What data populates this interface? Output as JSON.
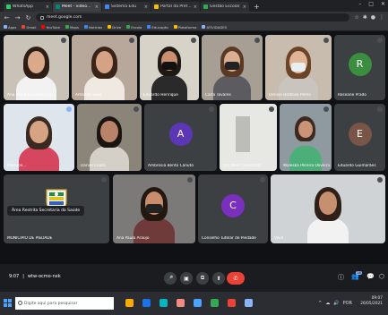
{
  "browser": {
    "tabs": [
      {
        "label": "WhatsApp",
        "fav": "#25d366",
        "active": false
      },
      {
        "label": "Meet - videochamada",
        "fav": "#00897b",
        "active": true
      },
      {
        "label": "Sistema Edu",
        "fav": "#4285f4",
        "active": false
      },
      {
        "label": "Portal da Prefeitura",
        "fav": "#fbbc04",
        "active": false
      },
      {
        "label": "Gestão Escolar",
        "fav": "#34a853",
        "active": false
      }
    ],
    "new_tab": "+",
    "window_controls": [
      "–",
      "□",
      "✕"
    ],
    "url": "meet.google.com",
    "bookmarks": [
      {
        "label": "Apps",
        "color": "#8ab4f8"
      },
      {
        "label": "Gmail",
        "color": "#ea4335"
      },
      {
        "label": "YouTube",
        "color": "#ff0000"
      },
      {
        "label": "Maps",
        "color": "#34a853"
      },
      {
        "label": "Notícias",
        "color": "#4285f4"
      },
      {
        "label": "Drive",
        "color": "#fbbc04"
      },
      {
        "label": "Escola",
        "color": "#34a853"
      },
      {
        "label": "Educação",
        "color": "#4285f4"
      },
      {
        "label": "Plataforma",
        "color": "#fbbc04"
      },
      {
        "label": "ATIVIDADES",
        "color": "#8ab4f8"
      }
    ]
  },
  "meeting": {
    "participants": [
      {
        "name": "Ana Paula Fonseca Cru...",
        "kind": "video",
        "scene": "woman-long-hair"
      },
      {
        "name": "Amanda Silva",
        "kind": "video",
        "scene": "woman-side"
      },
      {
        "name": "Eduardo Henrique",
        "kind": "video",
        "scene": "man-mask"
      },
      {
        "name": "Carla Tavares",
        "kind": "video",
        "scene": "woman-mask"
      },
      {
        "name": "Denise Barbosa Peres",
        "kind": "video",
        "scene": "woman-glasses-mask"
      },
      {
        "name": "Roseane Prado",
        "kind": "avatar",
        "letter": "R",
        "color": "#3b8e3f"
      },
      {
        "name": "Marluce...",
        "kind": "video",
        "scene": "woman-older",
        "pinned": true
      },
      {
        "name": "Daniel Couto",
        "kind": "video",
        "scene": "woman-dark"
      },
      {
        "name": "Ambrosia Bento Canuto",
        "kind": "avatar",
        "letter": "A",
        "color": "#5b36b5"
      },
      {
        "name": "LUCIMAR TEODORO",
        "kind": "video",
        "scene": "room-empty"
      },
      {
        "name": "Waleska Pereira Oliveira",
        "kind": "video",
        "scene": "room-outside"
      },
      {
        "name": "Eduardo Guimarães",
        "kind": "avatar",
        "letter": "E",
        "color": "#795548"
      },
      {
        "name": "MUNICÍPIO DE PIEDADE",
        "kind": "emblem"
      },
      {
        "name": "Ana Paula Araújo",
        "kind": "video",
        "scene": "woman-mask-2"
      },
      {
        "name": "Conselho Tutelar de Piedade",
        "kind": "avatar",
        "letter": "C",
        "color": "#7b2fbf"
      },
      {
        "name": "Você",
        "kind": "video",
        "scene": "self"
      }
    ],
    "caption": "Área Restrita Secretaria da Saúde",
    "meeting_time": "9:07",
    "meeting_code": "wtw-ocmo-nxk"
  },
  "controls": {
    "mic": "🎤",
    "camera": "▣",
    "captions": "⧉",
    "present": "⬆",
    "more": "⋮",
    "end": "✆",
    "info": "ⓘ",
    "people": "👥",
    "people_count": "16",
    "chat": "💬",
    "activities": "⬡"
  },
  "taskbar": {
    "search_placeholder": "Digite aqui para pesquisar",
    "apps": [
      "#f9ab00",
      "#1a73e8",
      "#00b7c3",
      "#f28b82",
      "#4aa3ff",
      "#34a853",
      "#ea4335",
      "#8ab4f8"
    ],
    "time": "09:07",
    "date": "26/05/2021",
    "tray": [
      "^",
      "☁",
      "🔊",
      "POR"
    ]
  }
}
